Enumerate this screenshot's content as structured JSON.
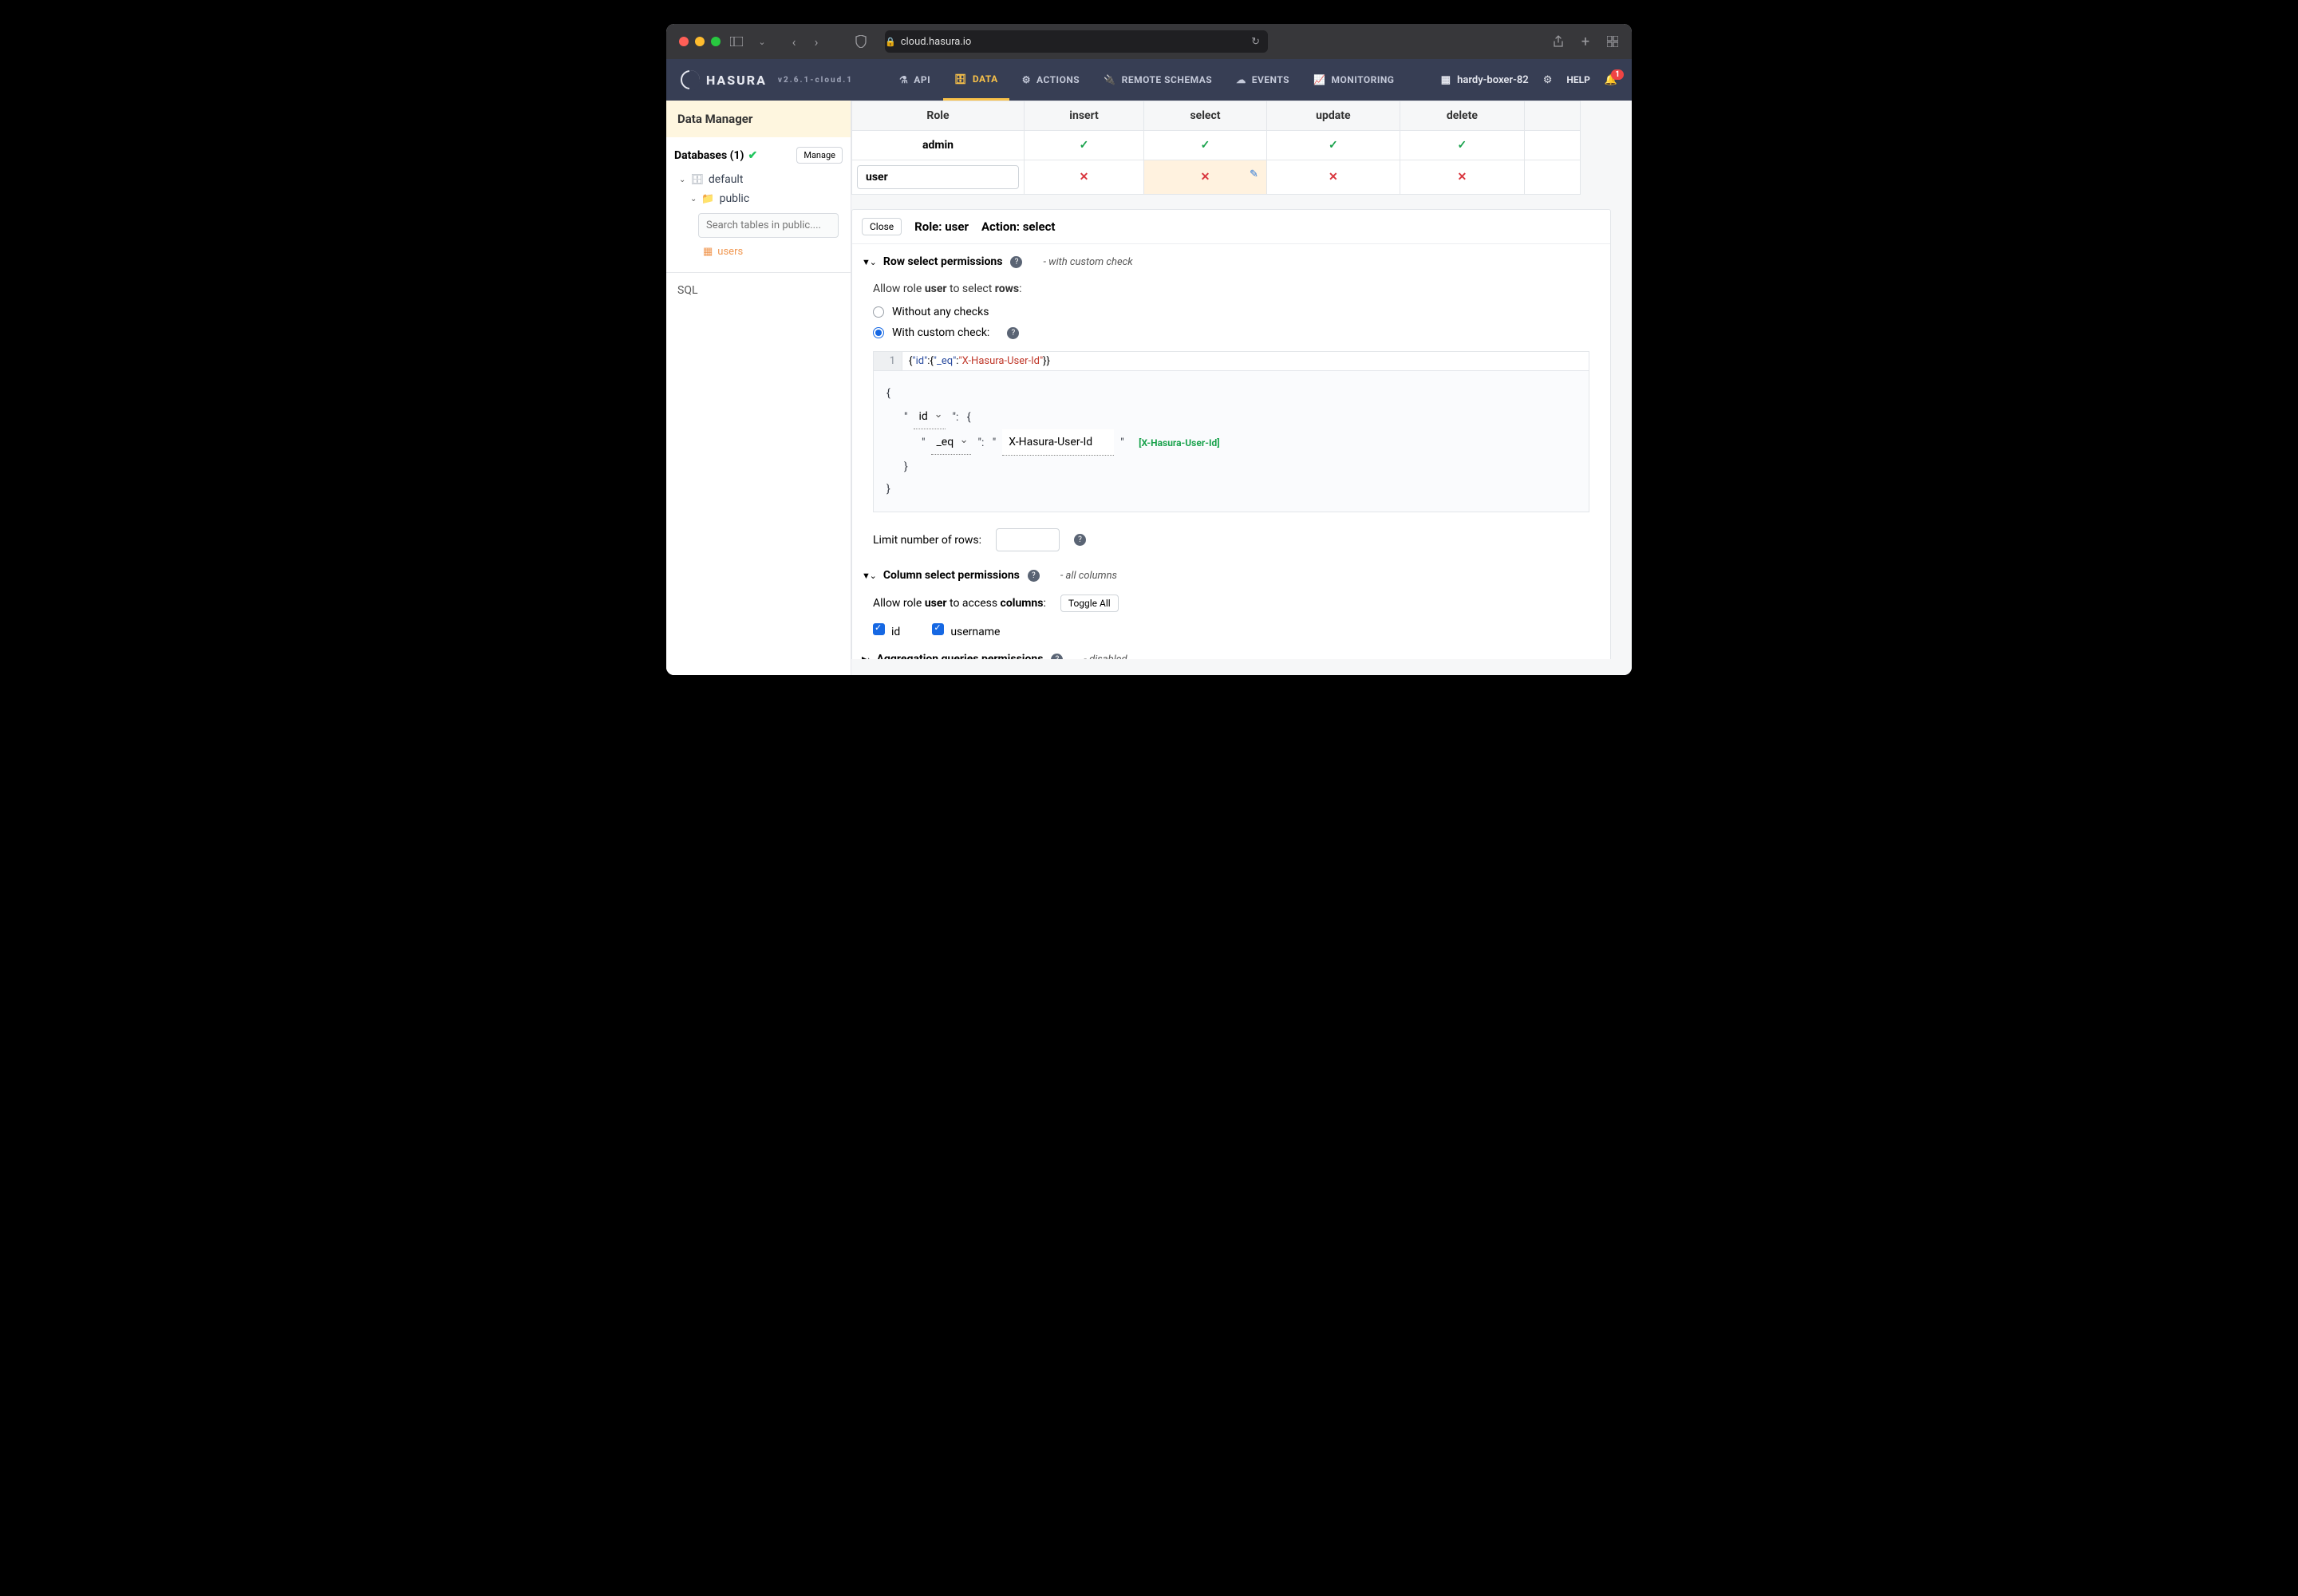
{
  "browser": {
    "url": "cloud.hasura.io"
  },
  "app": {
    "brand": "HASURA",
    "version": "v2.6.1-cloud.1",
    "project": "hardy-boxer-82",
    "help": "HELP",
    "notifCount": "1",
    "tabs": [
      {
        "label": "API"
      },
      {
        "label": "DATA"
      },
      {
        "label": "ACTIONS"
      },
      {
        "label": "REMOTE SCHEMAS"
      },
      {
        "label": "EVENTS"
      },
      {
        "label": "MONITORING"
      }
    ]
  },
  "sidebar": {
    "heading": "Data Manager",
    "dbLabel": "Databases (1)",
    "manage": "Manage",
    "dbName": "default",
    "schema": "public",
    "searchPlaceholder": "Search tables in public....",
    "table": "users",
    "sql": "SQL"
  },
  "perm": {
    "headers": [
      "Role",
      "insert",
      "select",
      "update",
      "delete"
    ],
    "adminRole": "admin",
    "userRole": "user"
  },
  "editor": {
    "close": "Close",
    "roleLabel": "Role: user",
    "actionLabel": "Action: select",
    "rowPerm": {
      "title": "Row select permissions",
      "hint": "- with custom check",
      "allow_pre": "Allow role ",
      "allow_role": "user",
      "allow_mid": " to select ",
      "allow_obj": "rows",
      "allow_post": ":",
      "opt1": "Without any checks",
      "opt2": "With custom check:",
      "codeLine": "1",
      "codeJson": {
        "pre": "{",
        "k1": "\"id\"",
        "c1": ":{",
        "k2": "\"_eq\"",
        "c2": ":",
        "s": "\"X-Hasura-User-Id\"",
        "post": "}}"
      },
      "builder": {
        "field": "id",
        "op": "_eq",
        "value": "X-Hasura-User-Id",
        "var": "[X-Hasura-User-Id]"
      },
      "limitLabel": "Limit number of rows:"
    },
    "colPerm": {
      "title": "Column select permissions",
      "hint": "- all columns",
      "allow_pre": "Allow role ",
      "allow_role": "user",
      "allow_mid": " to access ",
      "allow_obj": "columns",
      "allow_post": ":",
      "toggle": "Toggle All",
      "cols": [
        "id",
        "username"
      ]
    },
    "aggPerm": {
      "title": "Aggregation queries permissions",
      "hint": "- disabled"
    }
  }
}
